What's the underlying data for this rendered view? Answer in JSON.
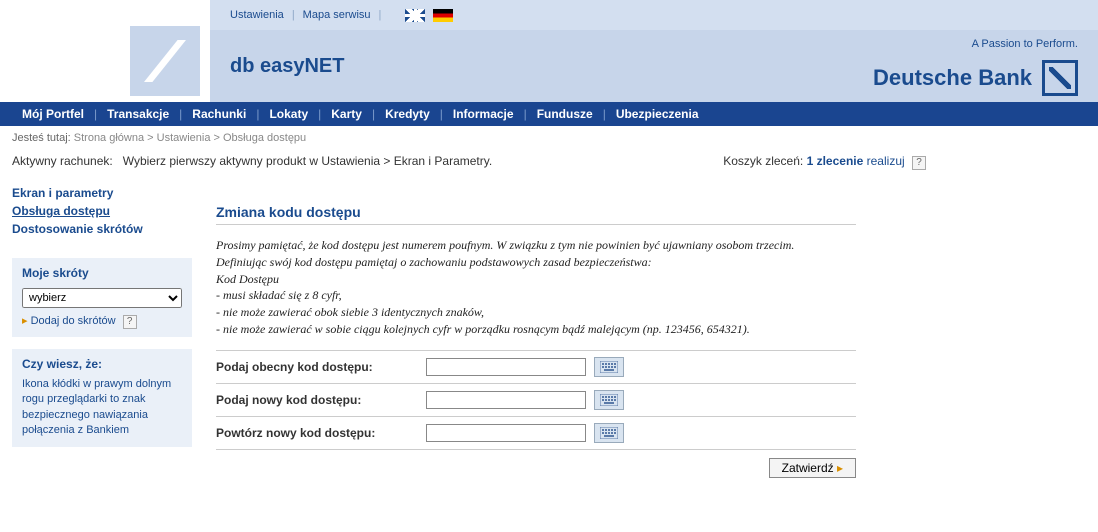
{
  "header": {
    "links": {
      "settings": "Ustawienia",
      "sitemap": "Mapa serwisu"
    },
    "product": "db easyNET",
    "tagline": "A Passion to Perform.",
    "bank": "Deutsche Bank"
  },
  "nav": {
    "items": [
      "Mój Portfel",
      "Transakcje",
      "Rachunki",
      "Lokaty",
      "Karty",
      "Kredyty",
      "Informacje",
      "Fundusze",
      "Ubezpieczenia"
    ]
  },
  "breadcrumb": {
    "label": "Jesteś tutaj:",
    "items": [
      "Strona główna",
      "Ustawienia",
      "Obsługa dostępu"
    ]
  },
  "info": {
    "active_label": "Aktywny rachunek:",
    "active_value": "Wybierz pierwszy aktywny produkt w Ustawienia > Ekran i Parametry.",
    "cart_label": "Koszyk zleceń:",
    "cart_count": "1 zlecenie",
    "cart_action": "realizuj"
  },
  "sidebar": {
    "nav": [
      "Ekran i parametry",
      "Obsługa dostępu",
      "Dostosowanie skrótów"
    ],
    "active_index": 1,
    "shortcuts": {
      "title": "Moje skróty",
      "select_value": "wybierz",
      "add_link": "Dodaj do skrótów"
    },
    "tip": {
      "title": "Czy wiesz, że:",
      "body": "Ikona kłódki w prawym dolnym rogu przeglądarki to znak bezpiecznego nawiązania połączenia z Bankiem"
    }
  },
  "main": {
    "title": "Zmiana kodu dostępu",
    "instructions": "Prosimy pamiętać, że kod dostępu jest numerem poufnym. W związku z tym nie powinien być ujawniany osobom trzecim.\nDefiniując swój kod dostępu pamiętaj o zachowaniu podstawowych zasad bezpieczeństwa:\nKod Dostępu\n- musi składać się z 8 cyfr,\n- nie może zawierać obok siebie 3 identycznych znaków,\n- nie może zawierać w sobie ciągu kolejnych cyfr w porządku rosnącym bądź malejącym (np. 123456, 654321).",
    "fields": {
      "current": "Podaj obecny kod dostępu:",
      "new": "Podaj nowy kod dostępu:",
      "repeat": "Powtórz nowy kod dostępu:"
    },
    "submit": "Zatwierdź"
  }
}
